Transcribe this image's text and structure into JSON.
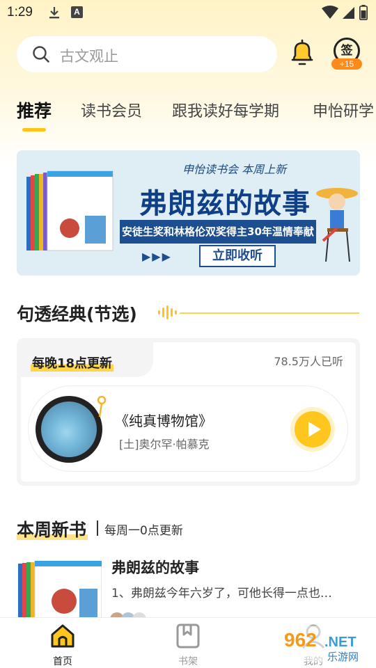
{
  "status_bar": {
    "time": "1:29",
    "a_badge": "A"
  },
  "search": {
    "placeholder": "古文观止"
  },
  "signin": {
    "label": "签",
    "badge": "+15"
  },
  "tabs": [
    {
      "label": "推荐",
      "active": true
    },
    {
      "label": "读书会员",
      "active": false
    },
    {
      "label": "跟我读好每学期",
      "active": false
    },
    {
      "label": "申怡研学",
      "active": false
    }
  ],
  "banner": {
    "kicker": "申怡读书会 本周上新",
    "title": "弗朗兹的故事",
    "subtitle": "安徒生奖和林格伦双奖得主30年温情奉献",
    "arrows": "▶▶▶",
    "cta": "立即收听",
    "book_cover_title": "弗朗兹的故事",
    "colors": {
      "title": "#0f3f86",
      "bg": "#dfeef5"
    }
  },
  "classics": {
    "title": "句透经典(节选)",
    "tag": "每晚18点更新",
    "listeners": "78.5万人已听",
    "track_title": "《纯真博物馆》",
    "track_author": "[土]奥尔罕·帕慕克"
  },
  "new_books": {
    "title": "本周新书",
    "subtitle": "每周一0点更新",
    "items": [
      {
        "title": "弗朗兹的故事",
        "desc": "1、弗朗兹今年六岁了，可他长得一点也…",
        "cover_title": "弗朗兹的故事"
      }
    ]
  },
  "bottom_nav": [
    {
      "label": "首页",
      "icon": "home-icon",
      "active": true
    },
    {
      "label": "书架",
      "icon": "bookshelf-icon",
      "active": false
    },
    {
      "label": "我的",
      "icon": "profile-icon",
      "active": false
    }
  ],
  "watermark": {
    "number": "962",
    "suffix": ".NET",
    "site": "乐游网"
  },
  "accent_color": "#ffc31a"
}
